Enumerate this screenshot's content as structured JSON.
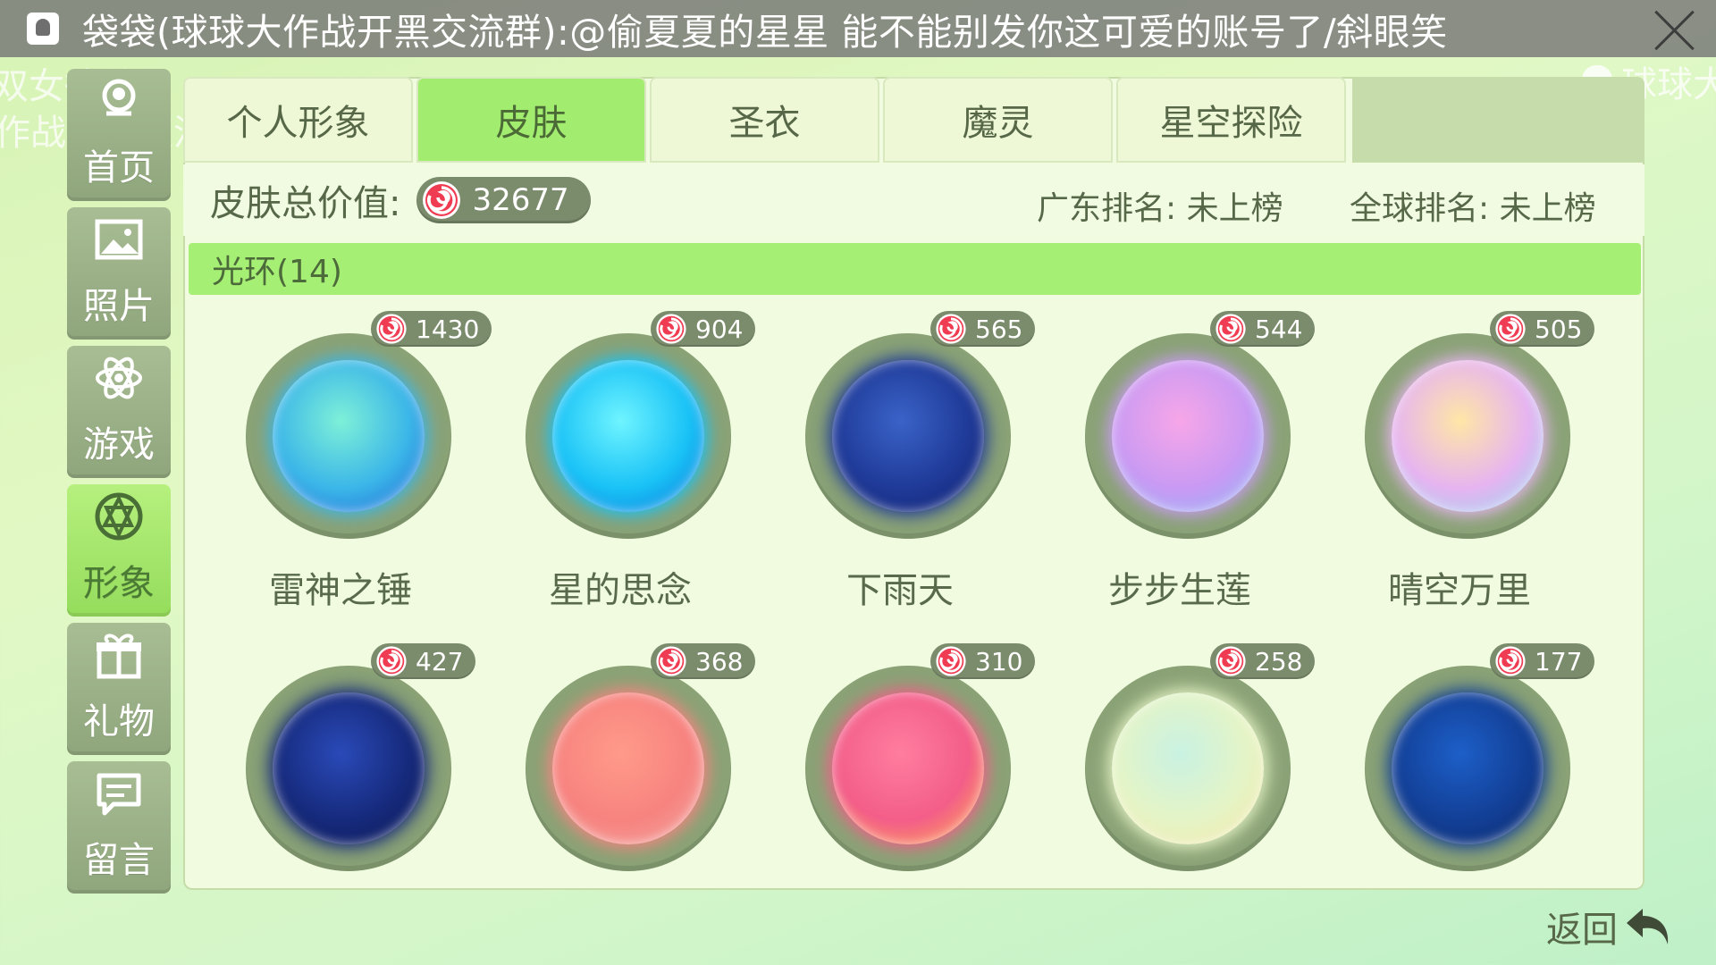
{
  "notification": {
    "message": "袋袋(球球大作战开黑交流群):@偷夏夏的星星 能不能别发你这可爱的账号了/斜眼笑"
  },
  "danmaku": {
    "line1": "双女徒弟",
    "line2": "作战开黑交流群 改名为:@阿毛很的好不好",
    "line3": "球球大"
  },
  "sidebar": {
    "items": [
      {
        "label": "首页",
        "icon": "home-icon"
      },
      {
        "label": "照片",
        "icon": "photo-icon"
      },
      {
        "label": "游戏",
        "icon": "atom-icon"
      },
      {
        "label": "形象",
        "icon": "avatar-icon",
        "active": true
      },
      {
        "label": "礼物",
        "icon": "gift-icon"
      },
      {
        "label": "留言",
        "icon": "message-icon"
      }
    ]
  },
  "tabs": [
    "个人形象",
    "皮肤",
    "圣衣",
    "魔灵",
    "星空探险"
  ],
  "active_tab": "皮肤",
  "summary": {
    "value_label": "皮肤总价值:",
    "total_value": "32677",
    "guangdong_rank": "广东排名: 未上榜",
    "global_rank": "全球排名: 未上榜"
  },
  "section": {
    "title": "光环(14)"
  },
  "items": [
    {
      "name": "雷神之锤",
      "price": "1430",
      "colors": [
        "#7ef0d8",
        "#3bb6e8",
        "#1d5fd6"
      ]
    },
    {
      "name": "星的思念",
      "price": "904",
      "colors": [
        "#6ff4ff",
        "#19c2f6",
        "#0b6fd8"
      ]
    },
    {
      "name": "下雨天",
      "price": "565",
      "colors": [
        "#3a63c8",
        "#1f3a98",
        "#0f1f6a"
      ]
    },
    {
      "name": "步步生莲",
      "price": "544",
      "colors": [
        "#f7a6e8",
        "#c99af3",
        "#8ab8f6"
      ]
    },
    {
      "name": "晴空万里",
      "price": "505",
      "colors": [
        "#ffe6a6",
        "#e6b4f0",
        "#8ed9f2"
      ]
    },
    {
      "name": "",
      "price": "427",
      "colors": [
        "#2a4ab8",
        "#162a7c",
        "#0b1650"
      ]
    },
    {
      "name": "",
      "price": "368",
      "colors": [
        "#ff9a8a",
        "#f7837f",
        "#f0aaa6"
      ]
    },
    {
      "name": "",
      "price": "310",
      "colors": [
        "#ff7d9f",
        "#f35e89",
        "#ffb347"
      ]
    },
    {
      "name": "",
      "price": "258",
      "colors": [
        "#c9f2e2",
        "#e5f4c6",
        "#f6e6a6"
      ]
    },
    {
      "name": "",
      "price": "177",
      "colors": [
        "#1d5fc8",
        "#123f96",
        "#0b2866"
      ]
    }
  ],
  "footer": {
    "back_label": "返回"
  }
}
